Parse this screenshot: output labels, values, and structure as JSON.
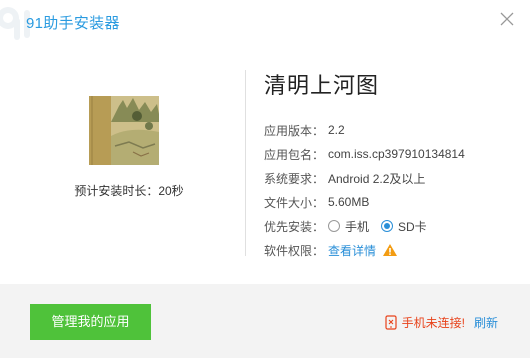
{
  "window": {
    "title": "91助手安装器",
    "close_icon": "close-icon"
  },
  "app": {
    "name": "清明上河图",
    "install_time": "预计安装时长：20秒",
    "fields": {
      "version_label": "应用版本：",
      "version_value": "2.2",
      "package_label": "应用包名：",
      "package_value": "com.iss.cp397910134814",
      "requirement_label": "系统要求：",
      "requirement_value": "Android 2.2及以上",
      "size_label": "文件大小：",
      "size_value": "5.60MB",
      "install_pref_label": "优先安装：",
      "install_pref_options": [
        "手机",
        "SD卡"
      ],
      "install_pref_selected": "SD卡",
      "permissions_label": "软件权限：",
      "permissions_link": "查看详情",
      "permissions_icon": "warning-icon"
    }
  },
  "footer": {
    "manage_button": "管理我的应用",
    "status_text": "手机未连接!",
    "refresh_link": "刷新",
    "status_icon": "phone-disconnected-icon"
  },
  "colors": {
    "accent": "#2a9be0",
    "button_green": "#4fc23a",
    "error": "#e8421a",
    "link": "#2a8fd8",
    "warning": "#f39c12"
  }
}
